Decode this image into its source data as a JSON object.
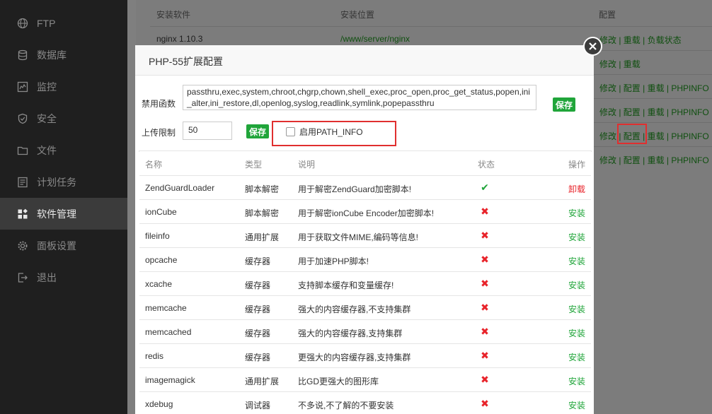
{
  "sidebar": {
    "items": [
      {
        "label": "FTP",
        "icon": "globe-icon"
      },
      {
        "label": "数据库",
        "icon": "database-icon"
      },
      {
        "label": "监控",
        "icon": "monitor-icon"
      },
      {
        "label": "安全",
        "icon": "shield-icon"
      },
      {
        "label": "文件",
        "icon": "folder-icon"
      },
      {
        "label": "计划任务",
        "icon": "list-icon"
      },
      {
        "label": "软件管理",
        "icon": "apps-icon",
        "active": true
      },
      {
        "label": "面板设置",
        "icon": "gear-icon"
      },
      {
        "label": "退出",
        "icon": "logout-icon"
      }
    ]
  },
  "software_table": {
    "headers": [
      "安装软件",
      "安装位置",
      "配置"
    ],
    "rows": [
      {
        "name": "nginx 1.10.3",
        "path": "/www/server/nginx",
        "actions": "修改 | 重载 | 负载状态"
      },
      {
        "actions": "修改 | 重载"
      },
      {
        "actions": "修改 | 配置 | 重载 | PHPINFO"
      },
      {
        "actions": "修改 | 配置 | 重载 | PHPINFO"
      },
      {
        "actions": "修改 | 配置 | 重载 | PHPINFO"
      },
      {
        "actions": "修改 | 配置 | 重载 | PHPINFO"
      }
    ]
  },
  "modal": {
    "title": "PHP-55扩展配置",
    "disabled_funcs_label": "禁用函数",
    "disabled_funcs_value": "passthru,exec,system,chroot,chgrp,chown,shell_exec,proc_open,proc_get_status,popen,ini_alter,ini_restore,dl,openlog,syslog,readlink,symlink,popepassthru",
    "save_label": "保存",
    "upload_label": "上传限制",
    "upload_value": "50",
    "pathinfo_label": "启用PATH_INFO",
    "pathinfo_checked": false,
    "table": {
      "headers": [
        "名称",
        "类型",
        "说明",
        "状态",
        "操作"
      ],
      "rows": [
        {
          "name": "ZendGuardLoader",
          "type": "脚本解密",
          "desc": "用于解密ZendGuard加密脚本!",
          "installed": true,
          "op": "卸载"
        },
        {
          "name": "ionCube",
          "type": "脚本解密",
          "desc": "用于解密ionCube Encoder加密脚本!",
          "installed": false,
          "op": "安装"
        },
        {
          "name": "fileinfo",
          "type": "通用扩展",
          "desc": "用于获取文件MIME,编码等信息!",
          "installed": false,
          "op": "安装"
        },
        {
          "name": "opcache",
          "type": "缓存器",
          "desc": "用于加速PHP脚本!",
          "installed": false,
          "op": "安装"
        },
        {
          "name": "xcache",
          "type": "缓存器",
          "desc": "支持脚本缓存和变量缓存!",
          "installed": false,
          "op": "安装"
        },
        {
          "name": "memcache",
          "type": "缓存器",
          "desc": "强大的内容缓存器,不支持集群",
          "installed": false,
          "op": "安装"
        },
        {
          "name": "memcached",
          "type": "缓存器",
          "desc": "强大的内容缓存器,支持集群",
          "installed": false,
          "op": "安装"
        },
        {
          "name": "redis",
          "type": "缓存器",
          "desc": "更强大的内容缓存器,支持集群",
          "installed": false,
          "op": "安装"
        },
        {
          "name": "imagemagick",
          "type": "通用扩展",
          "desc": "比GD更强大的图形库",
          "installed": false,
          "op": "安装"
        },
        {
          "name": "xdebug",
          "type": "调试器",
          "desc": "不多说,不了解的不要安装",
          "installed": false,
          "op": "安装"
        }
      ]
    }
  },
  "colors": {
    "accent": "#20a53a",
    "danger": "#e8232a",
    "highlight": "#e02f2f"
  }
}
